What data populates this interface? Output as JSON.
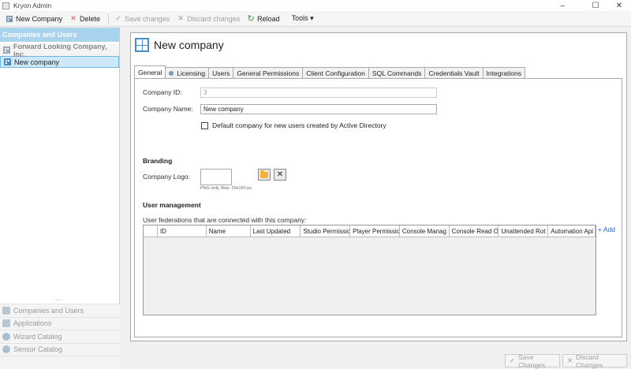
{
  "window": {
    "title": "Kryon Admin",
    "controls": {
      "minimize": "–",
      "maximize": "☐",
      "close": "✕"
    }
  },
  "toolbar": {
    "new_company": "New Company",
    "delete": "Delete",
    "save_changes": "Save changes",
    "discard_changes": "Discard changes",
    "reload": "Reload",
    "tools": "Tools ▾"
  },
  "sidebar": {
    "header": "Companies and Users",
    "tree": [
      {
        "label": "Forward Looking Company, Inc."
      },
      {
        "label": "New company"
      }
    ],
    "grip": "....",
    "nav": [
      {
        "label": "Companies and Users"
      },
      {
        "label": "Applications"
      },
      {
        "label": "Wizard Catalog"
      },
      {
        "label": "Sensor Catalog"
      }
    ]
  },
  "page": {
    "title": "New company",
    "tabs": [
      {
        "label": "General"
      },
      {
        "label": "Licensing"
      },
      {
        "label": "Users"
      },
      {
        "label": "General Permissions"
      },
      {
        "label": "Client Configuration"
      },
      {
        "label": "SQL Commands"
      },
      {
        "label": "Credentials Vault"
      },
      {
        "label": "Integrations"
      }
    ]
  },
  "general": {
    "company_id_label": "Company ID:",
    "company_id_value": "3",
    "company_name_label": "Company Name:",
    "company_name_value": "New company",
    "default_company_checkbox": "Default company for new users created by Active Directory",
    "branding_title": "Branding",
    "company_logo_label": "Company Logo:",
    "logo_hint": "PNG only, Max. 20x150 px.",
    "user_management_title": "User management",
    "federations_label": "User federations that are connected with this company:",
    "add_link": "+ Add",
    "grid_columns": [
      "ID",
      "Name",
      "Last Updated",
      "Studio Permissic",
      "Player Permissic",
      "Console Manag",
      "Console Read O",
      "Unattended Rot",
      "Automation Api"
    ]
  },
  "footer": {
    "save_changes": "Save Changes",
    "discard_changes": "Discard Changes"
  },
  "colors": {
    "accent": "#4a8fc7",
    "sidebar_header": "#a9d3ee",
    "selection": "#cde8f7",
    "link": "#2266cc"
  }
}
